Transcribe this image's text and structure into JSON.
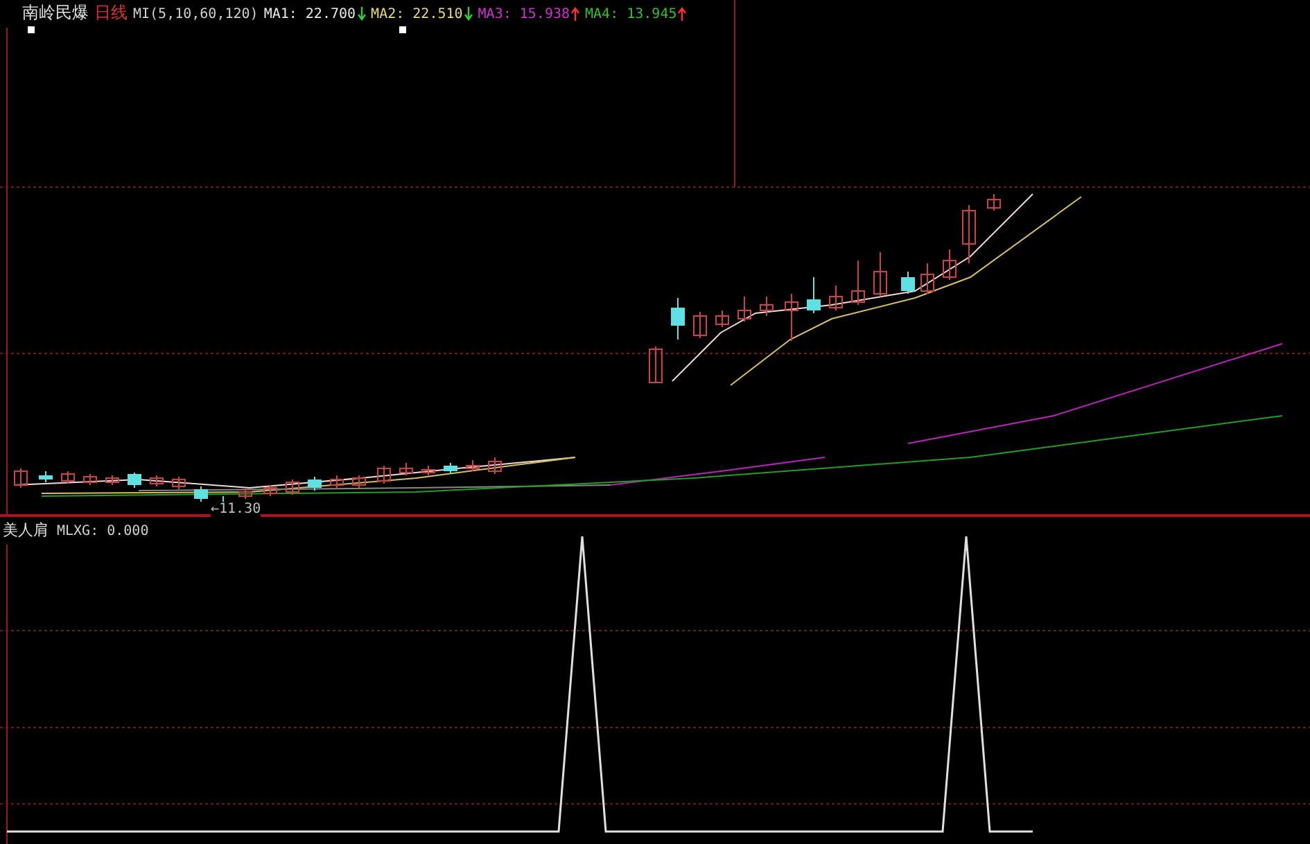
{
  "header": {
    "stock_name": "南岭民爆",
    "period": "日线",
    "indicator": "MI(5,10,60,120)",
    "averages": [
      {
        "name": "MA1:",
        "value": "22.700",
        "kind": "down",
        "color": "#e8e8e8"
      },
      {
        "name": "MA2:",
        "value": "22.510",
        "kind": "down",
        "color": "#e8d870"
      },
      {
        "name": "MA3:",
        "value": "15.938",
        "kind": "up",
        "color": "#d030d0"
      },
      {
        "name": "MA4:",
        "value": "13.945",
        "kind": "up",
        "color": "#30c030"
      }
    ]
  },
  "low_marker": {
    "arrow": "←",
    "value": "11.30"
  },
  "indicator_panel": {
    "name": "美人肩",
    "reading": "MLXG: 0.000"
  }
}
